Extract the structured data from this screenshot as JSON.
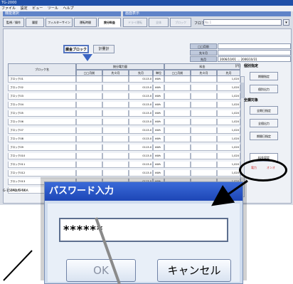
{
  "window": {
    "title": "TG-2000"
  },
  "menu": [
    "ファイル",
    "設定",
    "ビュー",
    "ツール",
    "ヘルプ"
  ],
  "sections": {
    "left": "機能選択",
    "right": "画面表示"
  },
  "toolbar_left": [
    "監視／操作",
    "履歴",
    "フィルターサイン",
    "運転時間",
    "按分料金"
  ],
  "toolbar_right": [
    "ドライ運転",
    "全体",
    "ブロック"
  ],
  "floor": {
    "label": "フロア",
    "value": "No.1"
  },
  "tabs": [
    "課金ブロック",
    "計量計"
  ],
  "period": {
    "labels": [
      "□□月前",
      "先々月",
      "先月"
    ],
    "last_month_value": "2006/10/01 … 2006/10/31"
  },
  "table": {
    "block_header": "ブロック名",
    "power_header": "按分電力量",
    "charge_header": "料金",
    "unit_header": "単位",
    "currency": "[円]",
    "sub_headers": [
      "□□月前",
      "先々月",
      "先月",
      "□□月前",
      "先々月",
      "先月"
    ],
    "rows": [
      {
        "name": "ブロック01",
        "power": "0113.0",
        "unit": "kWh",
        "charge": "1,020"
      },
      {
        "name": "ブロック02",
        "power": "0113.0",
        "unit": "kWh",
        "charge": "1,020"
      },
      {
        "name": "ブロック03",
        "power": "0113.0",
        "unit": "kWh",
        "charge": "1,020"
      },
      {
        "name": "ブロック04",
        "power": "0113.0",
        "unit": "kWh",
        "charge": "1,020"
      },
      {
        "name": "ブロック05",
        "power": "0113.0",
        "unit": "kWh",
        "charge": "1,020"
      },
      {
        "name": "ブロック06",
        "power": "0113.0",
        "unit": "kWh",
        "charge": "1,020"
      },
      {
        "name": "ブロック07",
        "power": "0113.0",
        "unit": "kWh",
        "charge": "1,020"
      },
      {
        "name": "ブロック08",
        "power": "0113.0",
        "unit": "kWh",
        "charge": "1,020"
      },
      {
        "name": "ブロック09",
        "power": "0113.0",
        "unit": "kWh",
        "charge": "1,020"
      },
      {
        "name": "ブロック010",
        "power": "0113.0",
        "unit": "kWh",
        "charge": "1,020"
      },
      {
        "name": "ブロック011",
        "power": "0113.0",
        "unit": "kWh",
        "charge": "1,020"
      },
      {
        "name": "ブロック012",
        "power": "0113.0",
        "unit": "kWh",
        "charge": "1,020"
      },
      {
        "name": "ブロック013",
        "power": "0113.0",
        "unit": "kWh",
        "charge": "1,020"
      },
      {
        "name": "ブロック014",
        "power": "0113.0",
        "unit": "kWh",
        "charge": "1,020"
      }
    ]
  },
  "side": {
    "individual_label": "個別指定",
    "individual_buttons": [
      "期間指定",
      "個別出力"
    ],
    "all_label": "全課対象",
    "all_buttons": [
      "全期日指定",
      "全個出力",
      "期間日指定"
    ],
    "charge_button": "料金設定",
    "bottom_labels": [
      "電力",
      "オンオ"
    ]
  },
  "bottom_id": "G-150AD/G-50A",
  "dialog": {
    "title": "パスワード入力",
    "password_value": "******",
    "ok_label": "OK",
    "cancel_label": "キャンセル"
  }
}
